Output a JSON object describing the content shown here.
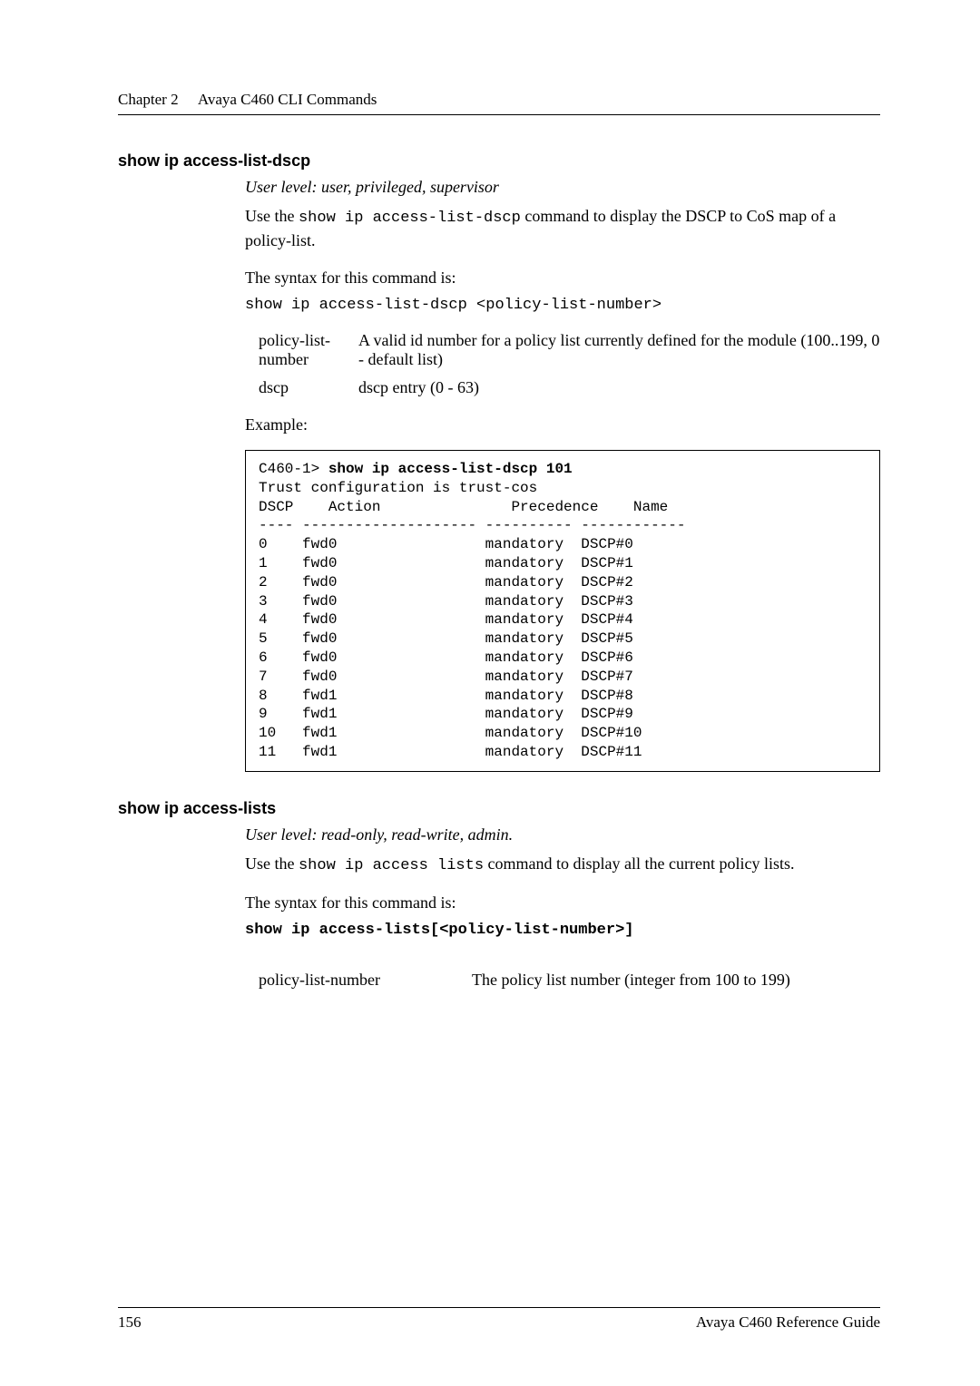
{
  "header": {
    "chapter": "Chapter 2",
    "title": "Avaya C460 CLI Commands"
  },
  "sec1": {
    "heading": "show ip access-list-dscp",
    "userlevel": "User level: user, privileged, supervisor",
    "desc_a": "Use the ",
    "desc_cmd": "show ip access-list-dscp",
    "desc_b": " command to display the DSCP to CoS map of a policy-list.",
    "syntax_label": "The syntax for this command is:",
    "syntax_cmd": "show ip access-list-dscp <policy-list-number>",
    "params": [
      {
        "name": "policy-list-number",
        "desc": "A valid id number for a policy list currently defined for the module (100..199, 0 - default list)"
      },
      {
        "name": "dscp",
        "desc": "dscp entry (0 - 63)"
      }
    ],
    "example_label": "Example:",
    "example_cmd_prefix": "C460-1> ",
    "example_cmd": "show ip access-list-dscp 101",
    "example_lines": [
      "Trust configuration is trust-cos",
      "DSCP    Action               Precedence    Name",
      "---- -------------------- ---------- ------------",
      "0    fwd0                 mandatory  DSCP#0",
      "1    fwd0                 mandatory  DSCP#1",
      "2    fwd0                 mandatory  DSCP#2",
      "3    fwd0                 mandatory  DSCP#3",
      "4    fwd0                 mandatory  DSCP#4",
      "5    fwd0                 mandatory  DSCP#5",
      "6    fwd0                 mandatory  DSCP#6",
      "7    fwd0                 mandatory  DSCP#7",
      "8    fwd1                 mandatory  DSCP#8",
      "9    fwd1                 mandatory  DSCP#9",
      "10   fwd1                 mandatory  DSCP#10",
      "11   fwd1                 mandatory  DSCP#11"
    ]
  },
  "sec2": {
    "heading": "show ip access-lists",
    "userlevel": "User level: read-only, read-write, admin.",
    "desc_a": "Use the ",
    "desc_cmd": "show ip access lists",
    "desc_b": " command to display all the current policy lists.",
    "syntax_label": "The syntax for this command is:",
    "syntax_cmd": "show ip access-lists[<policy-list-number>]",
    "params": [
      {
        "name": "policy-list-number",
        "desc": "The policy list number (integer from 100 to 199)"
      }
    ]
  },
  "footer": {
    "page": "156",
    "ref": "Avaya C460 Reference Guide"
  }
}
